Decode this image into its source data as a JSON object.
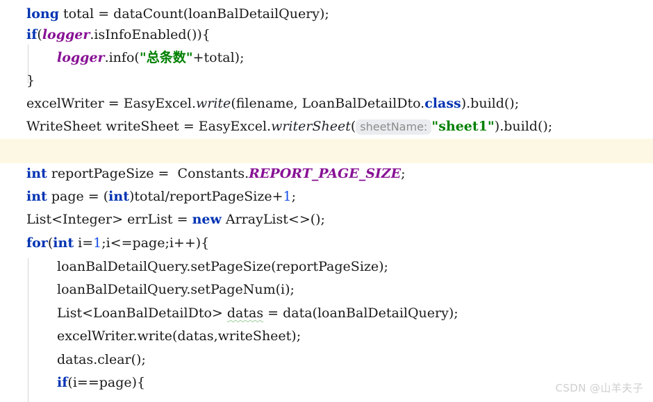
{
  "editor": {
    "language": "Java",
    "font_size_px": 19,
    "line_height_px": 33,
    "background_color": "#ffffff",
    "caret_line_color": "#fdf8e3",
    "indent_guide_color": "#d4d4d4",
    "colors": {
      "keyword": "#0033b3",
      "string": "#008000",
      "number": "#1750eb",
      "static_field": "#871094",
      "instance_field": "#871094",
      "static_method": "#20242a",
      "default_text": "#1a1a1a",
      "parameter_hint_bg": "#ebecf0",
      "parameter_hint_fg": "#8c8c8c",
      "spellcheck_squiggle": "#9ccc9c",
      "watermark": "#cfcfcf"
    },
    "lines": [
      {
        "index": 1,
        "indent": 0,
        "text": "long total = dataCount(loanBalDetailQuery);",
        "tokens": [
          {
            "t": "long",
            "k": "keyword"
          },
          {
            "t": " total = dataCount(loanBalDetailQuery);",
            "k": "plain"
          }
        ]
      },
      {
        "index": 2,
        "indent": 0,
        "text": "if(logger.isInfoEnabled()){",
        "tokens": [
          {
            "t": "if",
            "k": "keyword"
          },
          {
            "t": "(",
            "k": "plain"
          },
          {
            "t": "logger",
            "k": "instance_field"
          },
          {
            "t": ".isInfoEnabled()){",
            "k": "plain"
          }
        ]
      },
      {
        "index": 3,
        "indent": 1,
        "text": "logger.info(\"总条数\"+total);",
        "tokens": [
          {
            "t": "logger",
            "k": "instance_field"
          },
          {
            "t": ".info(",
            "k": "plain"
          },
          {
            "t": "\"总条数\"",
            "k": "string"
          },
          {
            "t": "+total);",
            "k": "plain"
          }
        ]
      },
      {
        "index": 4,
        "indent": 0,
        "text": "}",
        "tokens": [
          {
            "t": "}",
            "k": "plain"
          }
        ]
      },
      {
        "index": 5,
        "indent": 0,
        "text": "excelWriter = EasyExcel.write(filename, LoanBalDetailDto.class).build();",
        "tokens": [
          {
            "t": "excelWriter = EasyExcel.",
            "k": "plain"
          },
          {
            "t": "write",
            "k": "static_method"
          },
          {
            "t": "(filename, LoanBalDetailDto.",
            "k": "plain"
          },
          {
            "t": "class",
            "k": "keyword"
          },
          {
            "t": ").build();",
            "k": "plain"
          }
        ]
      },
      {
        "index": 6,
        "indent": 0,
        "text": "WriteSheet writeSheet = EasyExcel.writerSheet( sheetName: \"sheet1\").build();",
        "parameter_hint": "sheetName:",
        "tokens": [
          {
            "t": "WriteSheet writeSheet = EasyExcel.",
            "k": "plain"
          },
          {
            "t": "writerSheet",
            "k": "static_method"
          },
          {
            "t": "(",
            "k": "plain"
          },
          {
            "t": "sheetName:",
            "k": "parameter_hint"
          },
          {
            "t": "\"sheet1\"",
            "k": "string"
          },
          {
            "t": ").build();",
            "k": "plain"
          }
        ]
      },
      {
        "index": 7,
        "indent": 0,
        "text": "",
        "highlighted": true,
        "tokens": []
      },
      {
        "index": 8,
        "indent": 0,
        "text": "int reportPageSize =  Constants.REPORT_PAGE_SIZE;",
        "tokens": [
          {
            "t": "int",
            "k": "keyword"
          },
          {
            "t": " reportPageSize =  Constants.",
            "k": "plain"
          },
          {
            "t": "REPORT_PAGE_SIZE",
            "k": "static_field"
          },
          {
            "t": ";",
            "k": "plain"
          }
        ]
      },
      {
        "index": 9,
        "indent": 0,
        "text": "int page = (int)total/reportPageSize+1;",
        "tokens": [
          {
            "t": "int",
            "k": "keyword"
          },
          {
            "t": " page = (",
            "k": "plain"
          },
          {
            "t": "int",
            "k": "keyword"
          },
          {
            "t": ")total/reportPageSize+",
            "k": "plain"
          },
          {
            "t": "1",
            "k": "number"
          },
          {
            "t": ";",
            "k": "plain"
          }
        ]
      },
      {
        "index": 10,
        "indent": 0,
        "text": "List<Integer> errList = new ArrayList<>();",
        "tokens": [
          {
            "t": "List<Integer> errList = ",
            "k": "plain"
          },
          {
            "t": "new",
            "k": "keyword"
          },
          {
            "t": " ArrayList<>();",
            "k": "plain"
          }
        ]
      },
      {
        "index": 11,
        "indent": 0,
        "text": "for(int i=1;i<=page;i++){",
        "tokens": [
          {
            "t": "for",
            "k": "keyword"
          },
          {
            "t": "(",
            "k": "plain"
          },
          {
            "t": "int",
            "k": "keyword"
          },
          {
            "t": " i=",
            "k": "plain"
          },
          {
            "t": "1",
            "k": "number"
          },
          {
            "t": ";i<=page;i++){",
            "k": "plain"
          }
        ]
      },
      {
        "index": 12,
        "indent": 1,
        "text": "loanBalDetailQuery.setPageSize(reportPageSize);",
        "tokens": [
          {
            "t": "loanBalDetailQuery.setPageSize(reportPageSize);",
            "k": "plain"
          }
        ]
      },
      {
        "index": 13,
        "indent": 1,
        "text": "loanBalDetailQuery.setPageNum(i);",
        "tokens": [
          {
            "t": "loanBalDetailQuery.setPageNum(i);",
            "k": "plain"
          }
        ]
      },
      {
        "index": 14,
        "indent": 1,
        "text": "List<LoanBalDetailDto> datas = data(loanBalDetailQuery);",
        "spellcheck_word": "datas",
        "tokens": [
          {
            "t": "List<LoanBalDetailDto> ",
            "k": "plain"
          },
          {
            "t": "datas",
            "k": "spellcheck"
          },
          {
            "t": " = data(loanBalDetailQuery);",
            "k": "plain"
          }
        ]
      },
      {
        "index": 15,
        "indent": 1,
        "text": "excelWriter.write(datas,writeSheet);",
        "tokens": [
          {
            "t": "excelWriter.write(datas,writeSheet);",
            "k": "plain"
          }
        ]
      },
      {
        "index": 16,
        "indent": 1,
        "text": "datas.clear();",
        "tokens": [
          {
            "t": "datas.clear();",
            "k": "plain"
          }
        ]
      },
      {
        "index": 17,
        "indent": 1,
        "text": "if(i==page){",
        "tokens": [
          {
            "t": "if",
            "k": "keyword"
          },
          {
            "t": "(i==page){",
            "k": "plain"
          }
        ]
      }
    ]
  },
  "watermark": {
    "text": "CSDN @山羊夫子"
  }
}
